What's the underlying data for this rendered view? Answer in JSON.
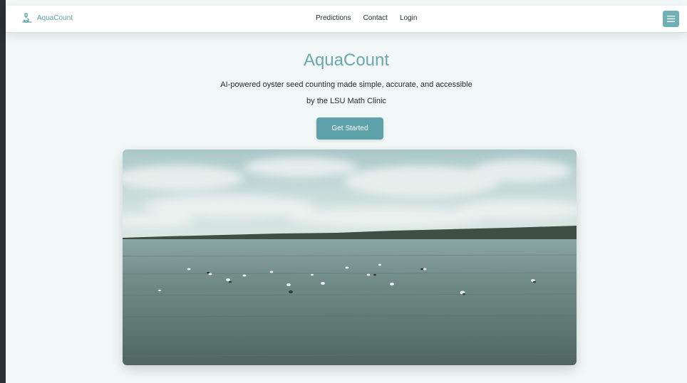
{
  "navbar": {
    "brand_name": "AquaCount",
    "brand_icon": "microscope-icon",
    "links": [
      "Predictions",
      "Contact",
      "Login"
    ],
    "menu_icon": "hamburger-menu-icon"
  },
  "hero": {
    "title": "AquaCount",
    "tagline_line1": "AI-powered oyster seed counting made simple, accurate, and accessible",
    "tagline_line2": "by the LSU Math Clinic",
    "cta_label": "Get Started"
  },
  "colors": {
    "accent": "#5fa1a8",
    "title": "#6aa7ae",
    "background": "#f2f8f8"
  }
}
